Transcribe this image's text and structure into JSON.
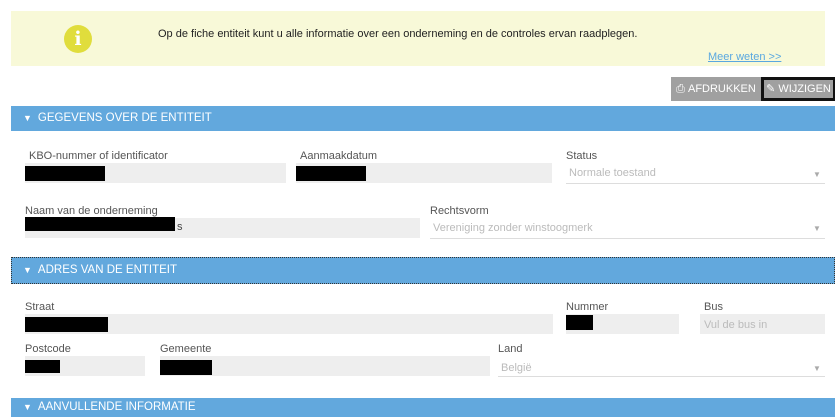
{
  "info": {
    "message": "Op de fiche entiteit kunt u alle informatie over een onderneming en de controles ervan raadplegen.",
    "link": "Meer weten >>",
    "icon": "info-icon"
  },
  "toolbar": {
    "print_label": "AFDRUKKEN",
    "edit_label": "WIJZIGEN"
  },
  "sections": {
    "entity": "GEGEVENS OVER DE ENTITEIT",
    "address": "ADRES VAN DE ENTITEIT",
    "extra": "AANVULLENDE INFORMATIE"
  },
  "entity": {
    "kbo_label": "KBO-nummer of identificator",
    "created_label": "Aanmaakdatum",
    "status_label": "Status",
    "status_value": "Normale toestand",
    "name_label": "Naam van de onderneming",
    "name_suffix": "s",
    "legal_label": "Rechtsvorm",
    "legal_value": "Vereniging zonder winstoogmerk"
  },
  "address": {
    "street_label": "Straat",
    "number_label": "Nummer",
    "bus_label": "Bus",
    "bus_placeholder": "Vul de bus in",
    "postcode_label": "Postcode",
    "city_label": "Gemeente",
    "country_label": "Land",
    "country_value": "België"
  },
  "colors": {
    "accent": "#62a8dd",
    "banner": "#f8f9d8"
  }
}
